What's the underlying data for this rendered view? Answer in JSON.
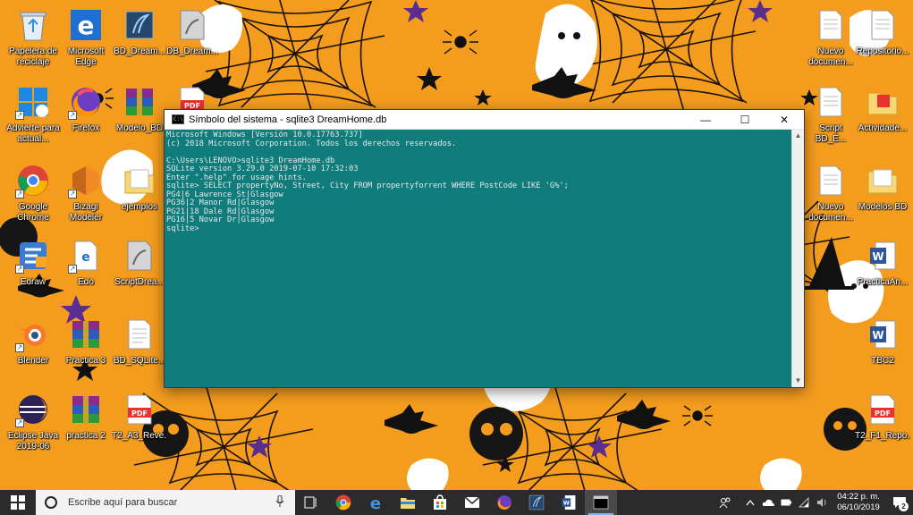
{
  "desktop": {
    "icons": [
      {
        "id": "recycle",
        "label": "Papelera de reciclaje"
      },
      {
        "id": "edge",
        "label": "Microsoft Edge"
      },
      {
        "id": "bdd-dream",
        "label": "BD_Dream..."
      },
      {
        "id": "db-dream",
        "label": "DB_Dream..."
      },
      {
        "id": "advierte",
        "label": "Advierte para actual..."
      },
      {
        "id": "firefox",
        "label": "Firefox"
      },
      {
        "id": "modelo-bd",
        "label": "Modelo_BD"
      },
      {
        "id": "pdf-1",
        "label": ""
      },
      {
        "id": "chrome",
        "label": "Google Chrome"
      },
      {
        "id": "bizagi",
        "label": "Bizagi Modeler"
      },
      {
        "id": "ejemplos",
        "label": "ejemplos"
      },
      {
        "id": "edraw",
        "label": "Edraw"
      },
      {
        "id": "edo",
        "label": "Edo"
      },
      {
        "id": "scriptdrea",
        "label": "ScriptDrea..."
      },
      {
        "id": "blender",
        "label": "Blender"
      },
      {
        "id": "practica3",
        "label": "Practica 3"
      },
      {
        "id": "bd-sqlite",
        "label": "BD_SQLite..."
      },
      {
        "id": "eclipse",
        "label": "Eclipse Java 2019-06"
      },
      {
        "id": "practica2",
        "label": "practica 2"
      },
      {
        "id": "t2-a3",
        "label": "T2_A3_Reve..."
      },
      {
        "id": "nuevo-doc-1",
        "label": "Nuevo documen..."
      },
      {
        "id": "repositorio",
        "label": "Repositorio..."
      },
      {
        "id": "script-bd",
        "label": "Script BD_E..."
      },
      {
        "id": "actividades",
        "label": "Actividade..."
      },
      {
        "id": "nuevo-doc-2",
        "label": "Nuevo documen..."
      },
      {
        "id": "modelos-bd",
        "label": "Modelos BD"
      },
      {
        "id": "practica-ar",
        "label": "PracticaAn..."
      },
      {
        "id": "tbc2",
        "label": "TBC2"
      },
      {
        "id": "t2-f1",
        "label": "T2_F1_Repo..."
      }
    ]
  },
  "console": {
    "title": "Símbolo del sistema - sqlite3  DreamHome.db",
    "app_icon": "C:\\",
    "controls": {
      "minimize": "—",
      "maximize": "☐",
      "close": "✕"
    },
    "lines": [
      "Microsoft Windows [Versión 10.0.17763.737]",
      "(c) 2018 Microsoft Corporation. Todos los derechos reservados.",
      "",
      "C:\\Users\\LENOVO>sqlite3 DreamHome.db",
      "SQLite version 3.29.0 2019-07-10 17:32:03",
      "Enter \".help\" for usage hints.",
      "sqlite> SELECT propertyNo, Street, City FROM propertyforrent WHERE PostCode LIKE 'G%';",
      "PG4|6 Lawrence St|Glasgow",
      "PG36|2 Manor Rd|Glasgow",
      "PG21|18 Dale Rd|Glasgow",
      "PG16|5 Novar Dr|Glasgow"
    ],
    "prompt": "sqlite> ",
    "cursor": "_"
  },
  "taskbar": {
    "search_placeholder": "Escribe aquí para buscar",
    "time": "04:22 p. m.",
    "date": "06/10/2019",
    "notification_count": "2"
  },
  "colors": {
    "wallpaper": "#f39c1e",
    "console_bg": "#107c7b",
    "taskbar_bg": "#2b2b2b"
  }
}
